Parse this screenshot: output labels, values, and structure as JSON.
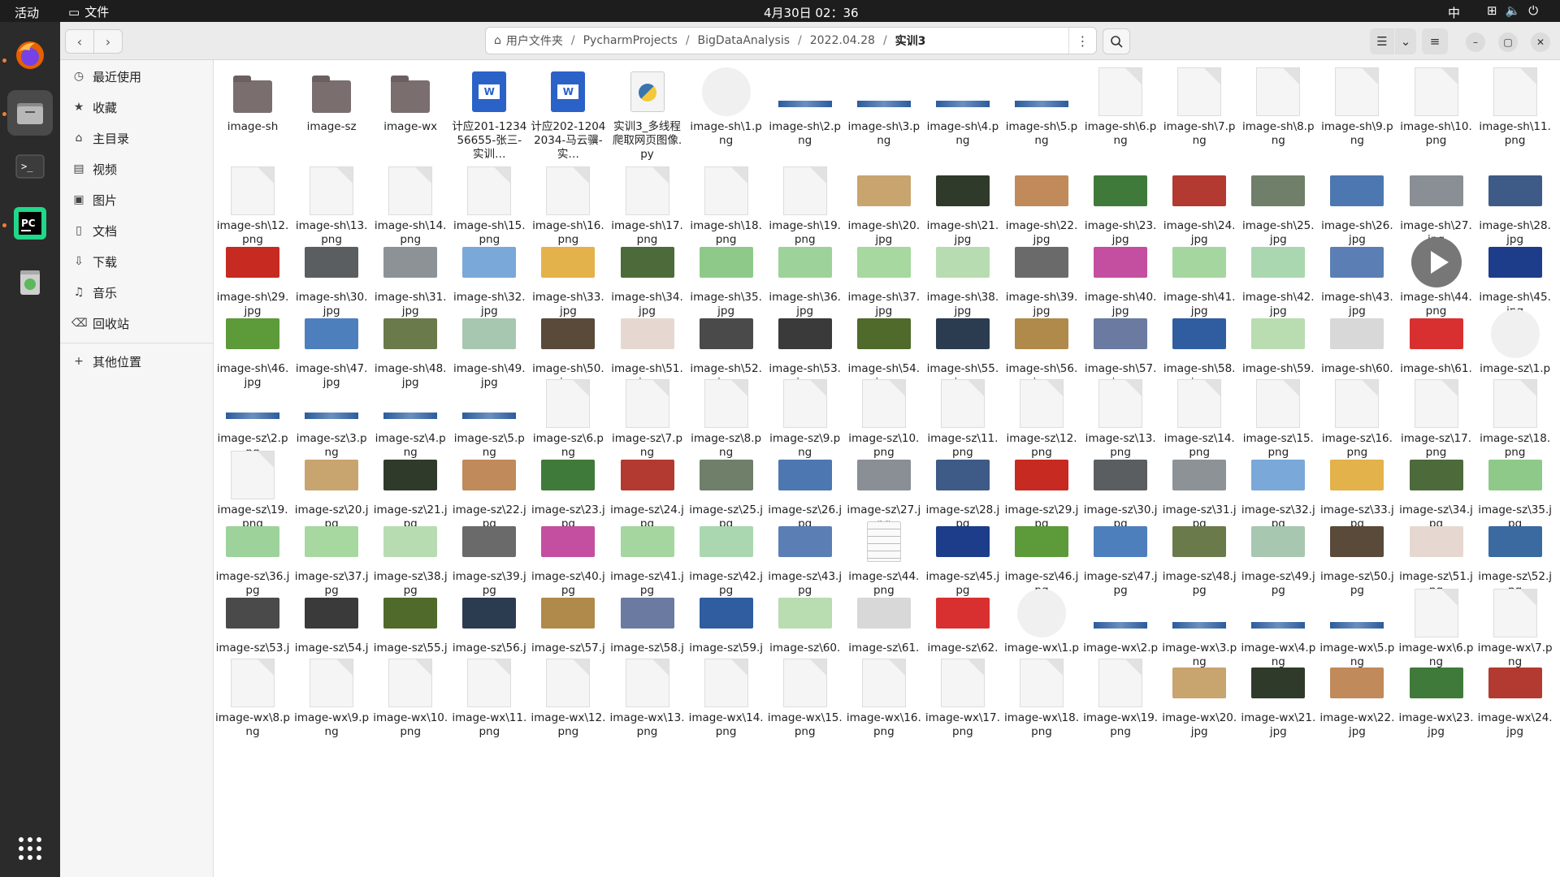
{
  "topbar": {
    "activities": "活动",
    "app_label": "文件",
    "clock": "4月30日  02：36",
    "ime": "中"
  },
  "header": {
    "path": [
      "用户文件夹",
      "PycharmProjects",
      "BigDataAnalysis",
      "2022.04.28",
      "实训3"
    ]
  },
  "sidebar": {
    "items": [
      {
        "label": "最近使用",
        "icon": "clock-icon"
      },
      {
        "label": "收藏",
        "icon": "star-icon"
      },
      {
        "label": "主目录",
        "icon": "home-icon"
      },
      {
        "label": "视频",
        "icon": "video-icon"
      },
      {
        "label": "图片",
        "icon": "image-icon"
      },
      {
        "label": "文档",
        "icon": "document-icon"
      },
      {
        "label": "下载",
        "icon": "download-icon"
      },
      {
        "label": "音乐",
        "icon": "music-icon"
      },
      {
        "label": "回收站",
        "icon": "trash-icon"
      }
    ],
    "other": "其他位置"
  },
  "files": [
    {
      "name": "image-sh",
      "kind": "folder"
    },
    {
      "name": "image-sz",
      "kind": "folder"
    },
    {
      "name": "image-wx",
      "kind": "folder"
    },
    {
      "name": "计应201-123456655-张三-实训…",
      "kind": "word"
    },
    {
      "name": "计应202-12042034-马云骥-实…",
      "kind": "word"
    },
    {
      "name": "实训3_多线程爬取网页图像.py",
      "kind": "py"
    },
    {
      "name": "image-sh\\1.png",
      "kind": "loading"
    },
    {
      "name": "image-sh\\2.png",
      "kind": "strip"
    },
    {
      "name": "image-sh\\3.png",
      "kind": "strip"
    },
    {
      "name": "image-sh\\4.png",
      "kind": "strip"
    },
    {
      "name": "image-sh\\5.png",
      "kind": "strip"
    },
    {
      "name": "image-sh\\6.png",
      "kind": "blank"
    },
    {
      "name": "image-sh\\7.png",
      "kind": "blank"
    },
    {
      "name": "image-sh\\8.png",
      "kind": "blank"
    },
    {
      "name": "image-sh\\9.png",
      "kind": "blank"
    },
    {
      "name": "image-sh\\10.png",
      "kind": "blank"
    },
    {
      "name": "image-sh\\11.png",
      "kind": "blank"
    },
    {
      "name": "image-sh\\12.png",
      "kind": "blank"
    },
    {
      "name": "image-sh\\13.png",
      "kind": "blank"
    },
    {
      "name": "image-sh\\14.png",
      "kind": "blank"
    },
    {
      "name": "image-sh\\15.png",
      "kind": "blank"
    },
    {
      "name": "image-sh\\16.png",
      "kind": "blank"
    },
    {
      "name": "image-sh\\17.png",
      "kind": "blank"
    },
    {
      "name": "image-sh\\18.png",
      "kind": "blank"
    },
    {
      "name": "image-sh\\19.png",
      "kind": "blank"
    },
    {
      "name": "image-sh\\20.jpg",
      "kind": "photo",
      "color": "#c8a46e"
    },
    {
      "name": "image-sh\\21.jpg",
      "kind": "photo",
      "color": "#2f3a2a"
    },
    {
      "name": "image-sh\\22.jpg",
      "kind": "photo",
      "color": "#c08a5a"
    },
    {
      "name": "image-sh\\23.jpg",
      "kind": "photo",
      "color": "#3f7a3a"
    },
    {
      "name": "image-sh\\24.jpg",
      "kind": "photo",
      "color": "#b33a30"
    },
    {
      "name": "image-sh\\25.jpg",
      "kind": "photo",
      "color": "#6f7f6a"
    },
    {
      "name": "image-sh\\26.jpg",
      "kind": "photo",
      "color": "#4d77b0"
    },
    {
      "name": "image-sh\\27.jpg",
      "kind": "photo",
      "color": "#8a8f95"
    },
    {
      "name": "image-sh\\28.jpg",
      "kind": "photo",
      "color": "#3e5a86"
    },
    {
      "name": "image-sh\\29.jpg",
      "kind": "photo",
      "color": "#c62a20"
    },
    {
      "name": "image-sh\\30.jpg",
      "kind": "photo",
      "color": "#5a5e60"
    },
    {
      "name": "image-sh\\31.jpg",
      "kind": "photo",
      "color": "#8d9296"
    },
    {
      "name": "image-sh\\32.jpg",
      "kind": "photo",
      "color": "#7aa8d8"
    },
    {
      "name": "image-sh\\33.jpg",
      "kind": "photo",
      "color": "#e3b24a"
    },
    {
      "name": "image-sh\\34.jpg",
      "kind": "photo",
      "color": "#4d6a3a"
    },
    {
      "name": "image-sh\\35.jpg",
      "kind": "photo",
      "color": "#8fc98a"
    },
    {
      "name": "image-sh\\36.jpg",
      "kind": "photo",
      "color": "#9dd39a"
    },
    {
      "name": "image-sh\\37.jpg",
      "kind": "photo",
      "color": "#a6d8a0"
    },
    {
      "name": "image-sh\\38.jpg",
      "kind": "photo",
      "color": "#b8dcb2"
    },
    {
      "name": "image-sh\\39.jpg",
      "kind": "photo",
      "color": "#6a6a6a"
    },
    {
      "name": "image-sh\\40.jpg",
      "kind": "photo",
      "color": "#c44fa0"
    },
    {
      "name": "image-sh\\41.jpg",
      "kind": "photo",
      "color": "#a5d6a0"
    },
    {
      "name": "image-sh\\42.jpg",
      "kind": "photo",
      "color": "#aad7b0"
    },
    {
      "name": "image-sh\\43.jpg",
      "kind": "photo",
      "color": "#5b7fb5"
    },
    {
      "name": "image-sh\\44.png",
      "kind": "play"
    },
    {
      "name": "image-sh\\45.jpg",
      "kind": "photo",
      "color": "#1d3d8a"
    },
    {
      "name": "image-sh\\46.jpg",
      "kind": "photo",
      "color": "#5d9a3a"
    },
    {
      "name": "image-sh\\47.jpg",
      "kind": "photo",
      "color": "#4e7fbd"
    },
    {
      "name": "image-sh\\48.jpg",
      "kind": "photo",
      "color": "#6a7a4a"
    },
    {
      "name": "image-sh\\49.jpg",
      "kind": "photo",
      "color": "#a7c7b0"
    },
    {
      "name": "image-sh\\50.jpg",
      "kind": "photo",
      "color": "#5a4a3a"
    },
    {
      "name": "image-sh\\51.jpg",
      "kind": "photo",
      "color": "#e6d8d0"
    },
    {
      "name": "image-sh\\52.jpg",
      "kind": "photo",
      "color": "#4a4a4a"
    },
    {
      "name": "image-sh\\53.jpg",
      "kind": "photo",
      "color": "#3a3a3a"
    },
    {
      "name": "image-sh\\54.jpg",
      "kind": "photo",
      "color": "#4f6a2a"
    },
    {
      "name": "image-sh\\55.jpg",
      "kind": "photo",
      "color": "#2c3c50"
    },
    {
      "name": "image-sh\\56.jpg",
      "kind": "photo",
      "color": "#b08a4a"
    },
    {
      "name": "image-sh\\57.jpg",
      "kind": "photo",
      "color": "#6a7aa0"
    },
    {
      "name": "image-sh\\58.jpg",
      "kind": "photo",
      "color": "#2f5da0"
    },
    {
      "name": "image-sh\\59.png",
      "kind": "photo",
      "color": "#b9dcb0"
    },
    {
      "name": "image-sh\\60.png",
      "kind": "photo",
      "color": "#d8d8d8"
    },
    {
      "name": "image-sh\\61.png",
      "kind": "photo",
      "color": "#d83030"
    },
    {
      "name": "image-sz\\1.png",
      "kind": "loading"
    },
    {
      "name": "image-sz\\2.png",
      "kind": "strip"
    },
    {
      "name": "image-sz\\3.png",
      "kind": "strip"
    },
    {
      "name": "image-sz\\4.png",
      "kind": "strip"
    },
    {
      "name": "image-sz\\5.png",
      "kind": "strip"
    },
    {
      "name": "image-sz\\6.png",
      "kind": "blank"
    },
    {
      "name": "image-sz\\7.png",
      "kind": "blank"
    },
    {
      "name": "image-sz\\8.png",
      "kind": "blank"
    },
    {
      "name": "image-sz\\9.png",
      "kind": "blank"
    },
    {
      "name": "image-sz\\10.png",
      "kind": "blank"
    },
    {
      "name": "image-sz\\11.png",
      "kind": "blank"
    },
    {
      "name": "image-sz\\12.png",
      "kind": "blank"
    },
    {
      "name": "image-sz\\13.png",
      "kind": "blank"
    },
    {
      "name": "image-sz\\14.png",
      "kind": "blank"
    },
    {
      "name": "image-sz\\15.png",
      "kind": "blank"
    },
    {
      "name": "image-sz\\16.png",
      "kind": "blank"
    },
    {
      "name": "image-sz\\17.png",
      "kind": "blank"
    },
    {
      "name": "image-sz\\18.png",
      "kind": "blank"
    },
    {
      "name": "image-sz\\19.png",
      "kind": "blank"
    },
    {
      "name": "image-sz\\20.jpg",
      "kind": "photo",
      "color": "#c8a46e"
    },
    {
      "name": "image-sz\\21.jpg",
      "kind": "photo",
      "color": "#2f3a2a"
    },
    {
      "name": "image-sz\\22.jpg",
      "kind": "photo",
      "color": "#c08a5a"
    },
    {
      "name": "image-sz\\23.jpg",
      "kind": "photo",
      "color": "#3f7a3a"
    },
    {
      "name": "image-sz\\24.jpg",
      "kind": "photo",
      "color": "#b33a30"
    },
    {
      "name": "image-sz\\25.jpg",
      "kind": "photo",
      "color": "#6f7f6a"
    },
    {
      "name": "image-sz\\26.jpg",
      "kind": "photo",
      "color": "#4d77b0"
    },
    {
      "name": "image-sz\\27.jpg",
      "kind": "photo",
      "color": "#8a8f95"
    },
    {
      "name": "image-sz\\28.jpg",
      "kind": "photo",
      "color": "#3e5a86"
    },
    {
      "name": "image-sz\\29.jpg",
      "kind": "photo",
      "color": "#c62a20"
    },
    {
      "name": "image-sz\\30.jpg",
      "kind": "photo",
      "color": "#5a5e60"
    },
    {
      "name": "image-sz\\31.jpg",
      "kind": "photo",
      "color": "#8d9296"
    },
    {
      "name": "image-sz\\32.jpg",
      "kind": "photo",
      "color": "#7aa8d8"
    },
    {
      "name": "image-sz\\33.jpg",
      "kind": "photo",
      "color": "#e3b24a"
    },
    {
      "name": "image-sz\\34.jpg",
      "kind": "photo",
      "color": "#4d6a3a"
    },
    {
      "name": "image-sz\\35.jpg",
      "kind": "photo",
      "color": "#8fc98a"
    },
    {
      "name": "image-sz\\36.jpg",
      "kind": "photo",
      "color": "#9dd39a"
    },
    {
      "name": "image-sz\\37.jpg",
      "kind": "photo",
      "color": "#a6d8a0"
    },
    {
      "name": "image-sz\\38.jpg",
      "kind": "photo",
      "color": "#b8dcb2"
    },
    {
      "name": "image-sz\\39.jpg",
      "kind": "photo",
      "color": "#6a6a6a"
    },
    {
      "name": "image-sz\\40.jpg",
      "kind": "photo",
      "color": "#c44fa0"
    },
    {
      "name": "image-sz\\41.jpg",
      "kind": "photo",
      "color": "#a5d6a0"
    },
    {
      "name": "image-sz\\42.jpg",
      "kind": "photo",
      "color": "#aad7b0"
    },
    {
      "name": "image-sz\\43.jpg",
      "kind": "photo",
      "color": "#5b7fb5"
    },
    {
      "name": "image-sz\\44.png",
      "kind": "text"
    },
    {
      "name": "image-sz\\45.jpg",
      "kind": "photo",
      "color": "#1d3d8a"
    },
    {
      "name": "image-sz\\46.jpg",
      "kind": "photo",
      "color": "#5d9a3a"
    },
    {
      "name": "image-sz\\47.jpg",
      "kind": "photo",
      "color": "#4e7fbd"
    },
    {
      "name": "image-sz\\48.jpg",
      "kind": "photo",
      "color": "#6a7a4a"
    },
    {
      "name": "image-sz\\49.jpg",
      "kind": "photo",
      "color": "#a7c7b0"
    },
    {
      "name": "image-sz\\50.jpg",
      "kind": "photo",
      "color": "#5a4a3a"
    },
    {
      "name": "image-sz\\51.jpg",
      "kind": "photo",
      "color": "#e6d8d0"
    },
    {
      "name": "image-sz\\52.jpg",
      "kind": "photo",
      "color": "#3a6aa0"
    },
    {
      "name": "image-sz\\53.jpg",
      "kind": "photo",
      "color": "#4a4a4a"
    },
    {
      "name": "image-sz\\54.jpg",
      "kind": "photo",
      "color": "#3a3a3a"
    },
    {
      "name": "image-sz\\55.jpg",
      "kind": "photo",
      "color": "#4f6a2a"
    },
    {
      "name": "image-sz\\56.jpg",
      "kind": "photo",
      "color": "#2c3c50"
    },
    {
      "name": "image-sz\\57.jpg",
      "kind": "photo",
      "color": "#b08a4a"
    },
    {
      "name": "image-sz\\58.jpg",
      "kind": "photo",
      "color": "#6a7aa0"
    },
    {
      "name": "image-sz\\59.jpg",
      "kind": "photo",
      "color": "#2f5da0"
    },
    {
      "name": "image-sz\\60.png",
      "kind": "photo",
      "color": "#b9dcb0"
    },
    {
      "name": "image-sz\\61.png",
      "kind": "photo",
      "color": "#d8d8d8"
    },
    {
      "name": "image-sz\\62.png",
      "kind": "photo",
      "color": "#d83030"
    },
    {
      "name": "image-wx\\1.png",
      "kind": "loading"
    },
    {
      "name": "image-wx\\2.png",
      "kind": "strip"
    },
    {
      "name": "image-wx\\3.png",
      "kind": "strip"
    },
    {
      "name": "image-wx\\4.png",
      "kind": "strip"
    },
    {
      "name": "image-wx\\5.png",
      "kind": "strip"
    },
    {
      "name": "image-wx\\6.png",
      "kind": "blank"
    },
    {
      "name": "image-wx\\7.png",
      "kind": "blank"
    },
    {
      "name": "image-wx\\8.png",
      "kind": "blank"
    },
    {
      "name": "image-wx\\9.png",
      "kind": "blank"
    },
    {
      "name": "image-wx\\10.png",
      "kind": "blank"
    },
    {
      "name": "image-wx\\11.png",
      "kind": "blank"
    },
    {
      "name": "image-wx\\12.png",
      "kind": "blank"
    },
    {
      "name": "image-wx\\13.png",
      "kind": "blank"
    },
    {
      "name": "image-wx\\14.png",
      "kind": "blank"
    },
    {
      "name": "image-wx\\15.png",
      "kind": "blank"
    },
    {
      "name": "image-wx\\16.png",
      "kind": "blank"
    },
    {
      "name": "image-wx\\17.png",
      "kind": "blank"
    },
    {
      "name": "image-wx\\18.png",
      "kind": "blank"
    },
    {
      "name": "image-wx\\19.png",
      "kind": "blank"
    },
    {
      "name": "image-wx\\20.jpg",
      "kind": "photo",
      "color": "#c8a46e"
    },
    {
      "name": "image-wx\\21.jpg",
      "kind": "photo",
      "color": "#2f3a2a"
    },
    {
      "name": "image-wx\\22.jpg",
      "kind": "photo",
      "color": "#c08a5a"
    },
    {
      "name": "image-wx\\23.jpg",
      "kind": "photo",
      "color": "#3f7a3a"
    },
    {
      "name": "image-wx\\24.jpg",
      "kind": "photo",
      "color": "#b33a30"
    }
  ]
}
